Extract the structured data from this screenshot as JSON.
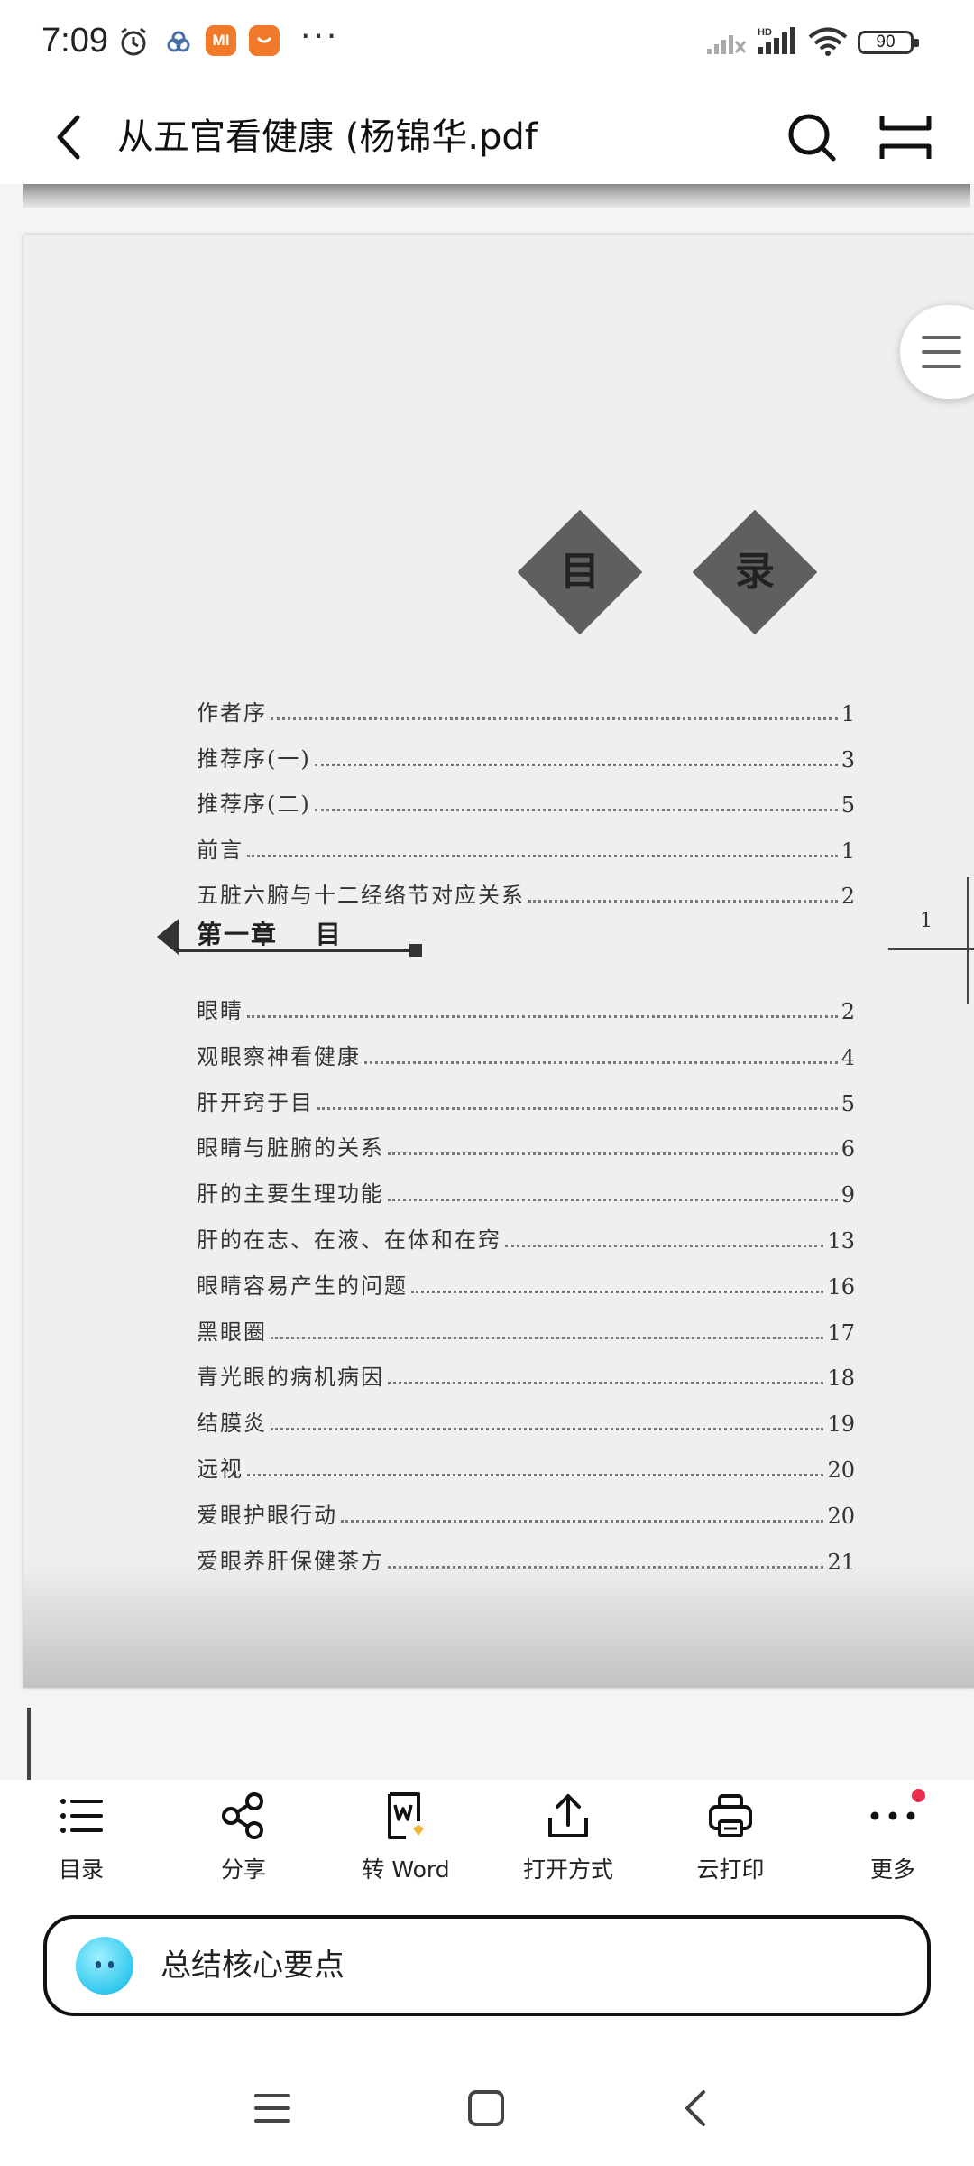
{
  "status_bar": {
    "time": "7:09",
    "app_badge_label": "MI",
    "more_dots": "···",
    "network_label": "HD",
    "battery": "90"
  },
  "header": {
    "title": "从五官看健康 (杨锦华.pdf"
  },
  "document": {
    "toc_title_chars": [
      "目",
      "录"
    ],
    "entries_before": [
      {
        "label": "作者序",
        "page": "1"
      },
      {
        "label": "推荐序(一)",
        "page": "3"
      },
      {
        "label": "推荐序(二)",
        "page": "5"
      },
      {
        "label": "前言",
        "page": "1"
      },
      {
        "label": "五脏六腑与十二经络节对应关系",
        "page": "2"
      }
    ],
    "chapter": "第一章　 目",
    "entries_after": [
      {
        "label": "眼睛",
        "page": "2"
      },
      {
        "label": "观眼察神看健康",
        "page": "4"
      },
      {
        "label": "肝开窍于目",
        "page": "5"
      },
      {
        "label": "眼睛与脏腑的关系",
        "page": "6"
      },
      {
        "label": "肝的主要生理功能",
        "page": "9"
      },
      {
        "label": "肝的在志、在液、在体和在窍",
        "page": "13"
      },
      {
        "label": "眼睛容易产生的问题",
        "page": "16"
      },
      {
        "label": "黑眼圈",
        "page": "17"
      },
      {
        "label": "青光眼的病机病因",
        "page": "18"
      },
      {
        "label": "结膜炎",
        "page": "19"
      },
      {
        "label": "远视",
        "page": "20"
      },
      {
        "label": "爱眼护眼行动",
        "page": "20"
      },
      {
        "label": "爱眼养肝保健茶方",
        "page": "21"
      }
    ],
    "next_page_number": "1"
  },
  "toolbar": {
    "items": [
      {
        "label": "目录",
        "icon": "list-icon"
      },
      {
        "label": "分享",
        "icon": "share-icon"
      },
      {
        "label": "转 Word",
        "icon": "word-convert-icon"
      },
      {
        "label": "打开方式",
        "icon": "upload-icon"
      },
      {
        "label": "云打印",
        "icon": "printer-icon"
      },
      {
        "label": "更多",
        "icon": "more-dots-icon"
      }
    ]
  },
  "ai_bar": {
    "text": "总结核心要点"
  },
  "colors": {
    "notification_dot": "#ea2d4f",
    "mi_badge": "#f07a2a",
    "ai_avatar": "#33c8ee"
  }
}
